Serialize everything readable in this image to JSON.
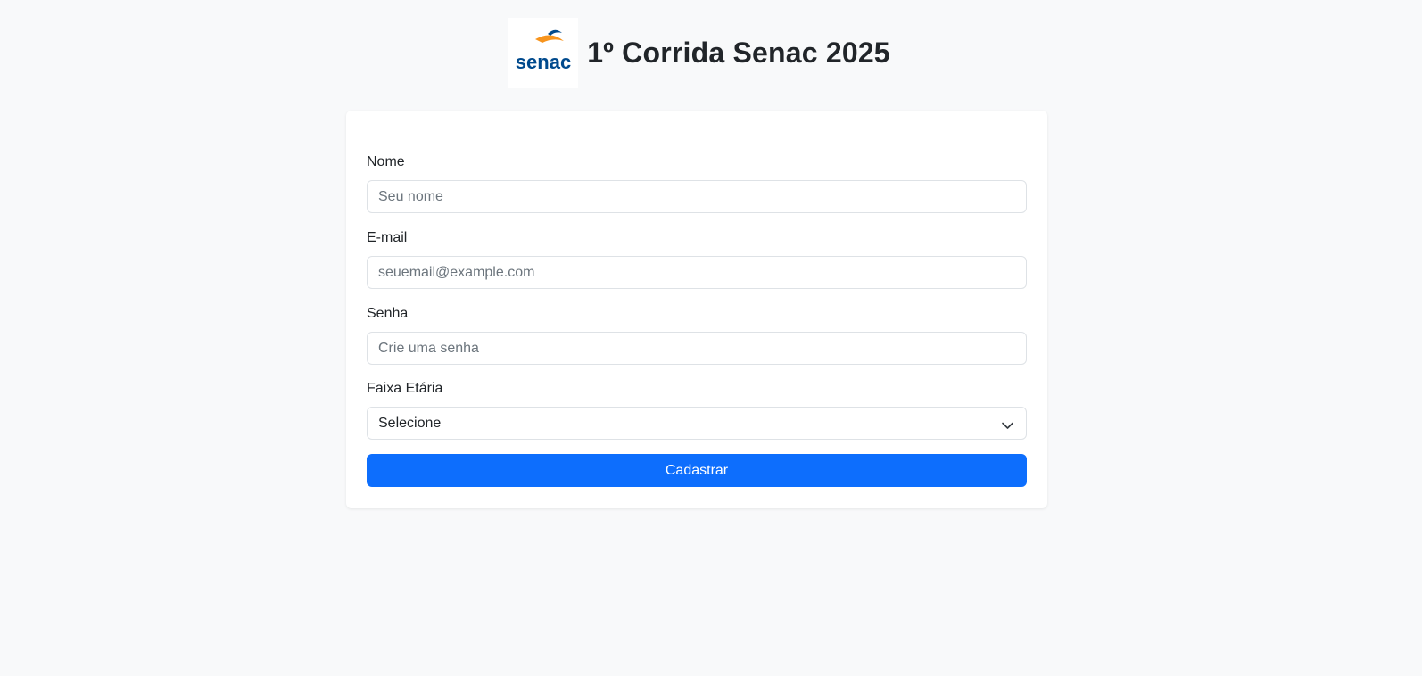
{
  "header": {
    "title": "1º Corrida Senac 2025",
    "logo_text": "senac",
    "logo_icon": "senac-logo"
  },
  "form": {
    "fields": [
      {
        "label": "Nome",
        "placeholder": "Seu nome",
        "value": ""
      },
      {
        "label": "E-mail",
        "placeholder": "seuemail@example.com",
        "value": ""
      },
      {
        "label": "Senha",
        "placeholder": "Crie uma senha",
        "value": ""
      }
    ],
    "age_range": {
      "label": "Faixa Etária",
      "selected": "Selecione",
      "icon": "chevron-down-icon"
    },
    "submit_label": "Cadastrar"
  },
  "colors": {
    "background": "#f8f9fa",
    "primary": "#0d6efd",
    "logo_blue": "#004a8d",
    "logo_orange": "#f7941d"
  }
}
